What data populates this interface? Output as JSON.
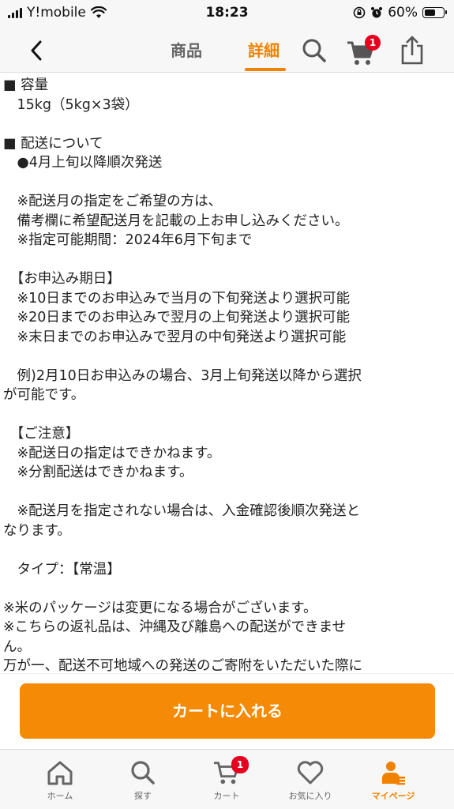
{
  "status_bar": {
    "carrier": "Y!mobile",
    "time": "18:23",
    "battery_percent": "60%",
    "battery_level": 0.6
  },
  "header": {
    "tabs": [
      {
        "label": "商品",
        "active": false
      },
      {
        "label": "詳細",
        "active": true
      }
    ],
    "cart_badge": "1",
    "icons": [
      "chevron-left-icon",
      "search-icon",
      "cart-icon",
      "share-icon"
    ]
  },
  "content": {
    "lines": [
      "■ 容量",
      "　15kg（5kg×3袋）",
      "",
      "■ 配送について",
      "　●4月上旬以降順次発送",
      "",
      "　※配送月の指定をご希望の方は、",
      "　備考欄に希望配送月を記載の上お申し込みください。",
      "　※指定可能期間：2024年6月下旬まで",
      "",
      "　【お申込み期日】",
      "　※10日までのお申込みで当月の下旬発送より選択可能",
      "　※20日までのお申込みで翌月の上旬発送より選択可能",
      "　※末日までのお申込みで翌月の中旬発送より選択可能",
      "",
      "　例)2月10日お申込みの場合、3月上旬発送以降から選択",
      "が可能です。",
      "",
      "　【ご注意】",
      "　※配送日の指定はできかねます。",
      "　※分割配送はできかねます。",
      "",
      "　※配送月を指定されない場合は、入金確認後順次発送と",
      "なります。",
      "",
      "　タイプ：【常温】",
      "",
      "※米のパッケージは変更になる場合がございます。",
      "※こちらの返礼品は、沖縄及び離島への配送ができませ",
      "ん。",
      "万が一、配送不可地域への発送のご寄附をいただいた際に"
    ]
  },
  "cta": {
    "label": "カートに入れる",
    "color": "#f58a06"
  },
  "tab_bar": {
    "items": [
      {
        "label": "ホーム",
        "icon": "home-icon"
      },
      {
        "label": "探す",
        "icon": "search-icon"
      },
      {
        "label": "カート",
        "icon": "cart-icon",
        "badge": "1"
      },
      {
        "label": "お気に入り",
        "icon": "heart-icon"
      },
      {
        "label": "マイページ",
        "icon": "user-icon",
        "active": true
      }
    ]
  },
  "colors": {
    "accent": "#f08200",
    "badge": "#e5001f"
  }
}
